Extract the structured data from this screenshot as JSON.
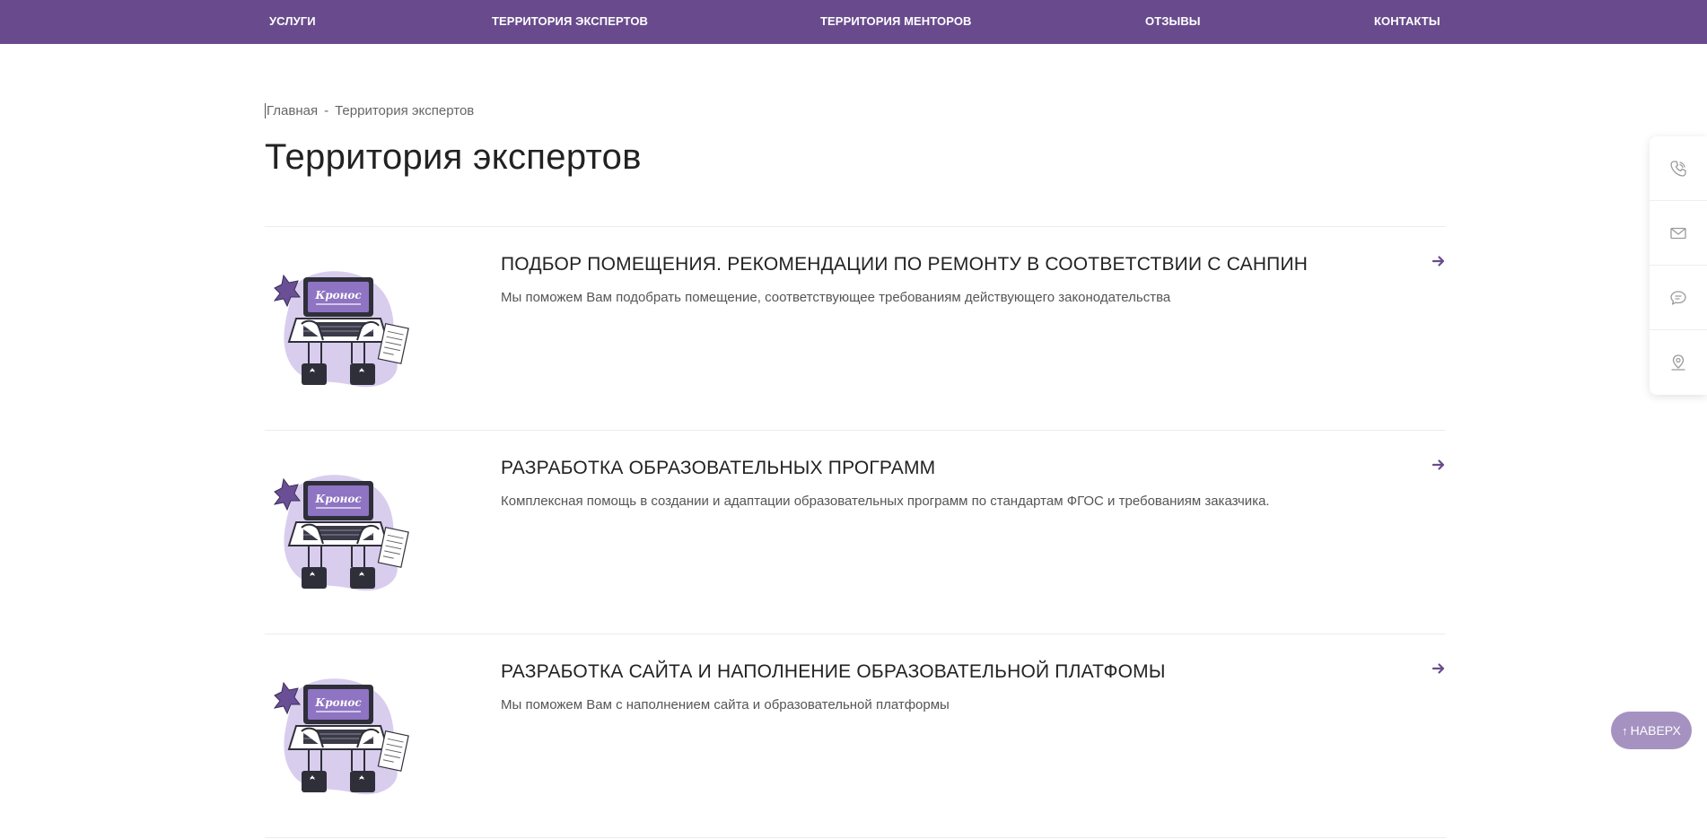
{
  "nav": {
    "items": [
      "УСЛУГИ",
      "ТЕРРИТОРИЯ ЭКСПЕРТОВ",
      "ТЕРРИТОРИЯ МЕНТОРОВ",
      "ОТЗЫВЫ",
      "КОНТАКТЫ"
    ]
  },
  "breadcrumb": {
    "home": "Главная",
    "separator": "-",
    "current": "Территория экспертов"
  },
  "page": {
    "title": "Территория экспертов"
  },
  "services": [
    {
      "title": "ПОДБОР ПОМЕЩЕНИЯ. РЕКОМЕНДАЦИИ ПО РЕМОНТУ В СООТВЕТСТВИИ С САНПИН",
      "description": "Мы поможем Вам подобрать помещение, соответствующее требованиям действующего законодательства",
      "logo_text": "Кронос"
    },
    {
      "title": "РАЗРАБОТКА ОБРАЗОВАТЕЛЬНЫХ ПРОГРАММ",
      "description": "Комплексная помощь в создании и адаптации образовательных программ по стандартам ФГОС и требованиям заказчика.",
      "logo_text": "Кронос"
    },
    {
      "title": "РАЗРАБОТКА САЙТА И НАПОЛНЕНИЕ ОБРАЗОВАТЕЛЬНОЙ ПЛАТФОМЫ",
      "description": "Мы поможем Вам с наполнением сайта и образовательной платформы",
      "logo_text": "Кронос"
    }
  ],
  "side_panel": {
    "icons": [
      "phone-icon",
      "mail-icon",
      "chat-icon",
      "location-icon"
    ]
  },
  "to_top": {
    "label": "НАВЕРХ"
  },
  "colors": {
    "brand": "#694b8d",
    "to_top_bg": "#a592c1",
    "illustration_light": "#d9cdee"
  }
}
